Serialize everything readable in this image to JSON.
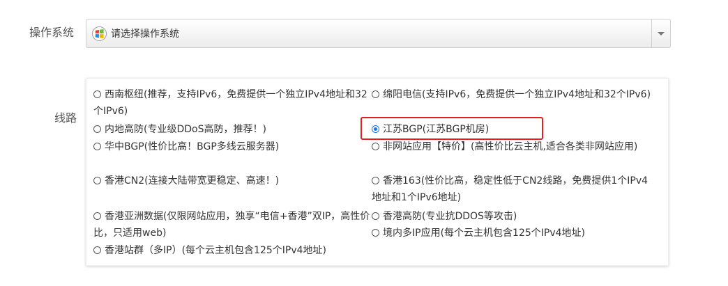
{
  "os": {
    "label": "操作系统",
    "placeholder": "请选择操作系统",
    "icon": "windows-logo-icon"
  },
  "line": {
    "label": "线路",
    "selected": "江苏BGP(江苏BGP机房)",
    "options": [
      {
        "text": "西南枢纽(推荐，支持IPv6，免费提供一个独立IPv4地址和32个IPv6)",
        "checked": false
      },
      {
        "text": "绵阳电信(支持IPv6，免费提供一个独立IPv4地址和32个IPv6)",
        "checked": false
      },
      {
        "text": "内地高防(专业级DDoS高防，推荐！)",
        "checked": false
      },
      {
        "text": "江苏BGP(江苏BGP机房)",
        "checked": true
      },
      {
        "text": "华中BGP(性价比高！BGP多线云服务器)",
        "checked": false
      },
      {
        "text": "非网站应用【特价】(高性价比云主机,适合各类非网站应用)",
        "checked": false
      },
      {
        "text": "香港CN2(连接大陆带宽更稳定、高速！)",
        "checked": false
      },
      {
        "text": "香港163(性价比高，稳定性低于CN2线路，免费提供1个IPv4地址和1个IPv6地址)",
        "checked": false
      },
      {
        "text": "香港亚洲数据(仅限网站应用，独享“电信+香港”双IP，高性价比，只适用web)",
        "checked": false
      },
      {
        "text": "香港高防(专业抗DDOS等攻击)",
        "checked": false
      },
      {
        "text": "香港站群（多IP）(每个云主机包含125个IPv4地址)",
        "checked": false
      },
      {
        "text": "境内多IP应用(每个云主机包含125个IPv4地址)",
        "checked": false
      }
    ]
  },
  "colors": {
    "highlight": "#e02020",
    "radio_checked": "#1a73e8"
  }
}
